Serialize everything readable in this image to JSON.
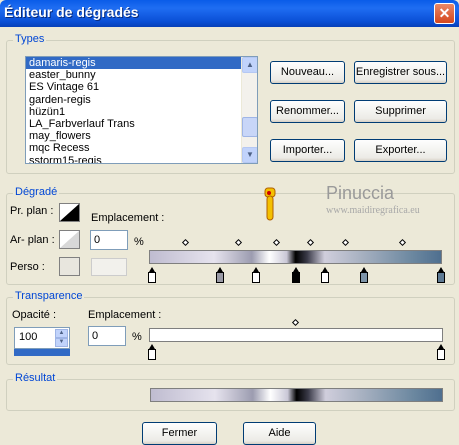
{
  "window": {
    "title": "Éditeur de dégradés",
    "close_glyph": "✕"
  },
  "types": {
    "label": "Types",
    "items": [
      "damaris-regis",
      "easter_bunny",
      "ES Vintage 61",
      "garden-regis",
      "hüzün1",
      "LA_Farbverlauf Trans",
      "may_flowers",
      "mqc Recess",
      "sstorm15-regis"
    ],
    "selected_index": 0,
    "buttons": {
      "new": "Nouveau...",
      "save_as": "Enregistrer sous...",
      "rename": "Renommer...",
      "delete": "Supprimer",
      "import": "Importer...",
      "export": "Exporter..."
    }
  },
  "gradient": {
    "label": "Dégradé",
    "foreground_label": "Pr. plan :",
    "background_label": "Ar- plan :",
    "custom_label": "Perso :",
    "location_label": "Emplacement :",
    "location_value": "0",
    "percent": "%",
    "colors": [
      "#c9c4d6",
      "#e0dcea",
      "#8a8aa0",
      "#000000",
      "#b4b2c6",
      "#6f8aa2",
      "#4f6f8f"
    ]
  },
  "transparency": {
    "label": "Transparence",
    "opacity_label": "Opacité :",
    "opacity_value": "100",
    "location_label": "Emplacement :",
    "location_value": "0",
    "percent": "%"
  },
  "result": {
    "label": "Résultat"
  },
  "footer": {
    "ok": "Fermer",
    "help": "Aide"
  },
  "watermark": {
    "title": "Pinuccia",
    "url": "www.maidiregrafica.eu"
  }
}
